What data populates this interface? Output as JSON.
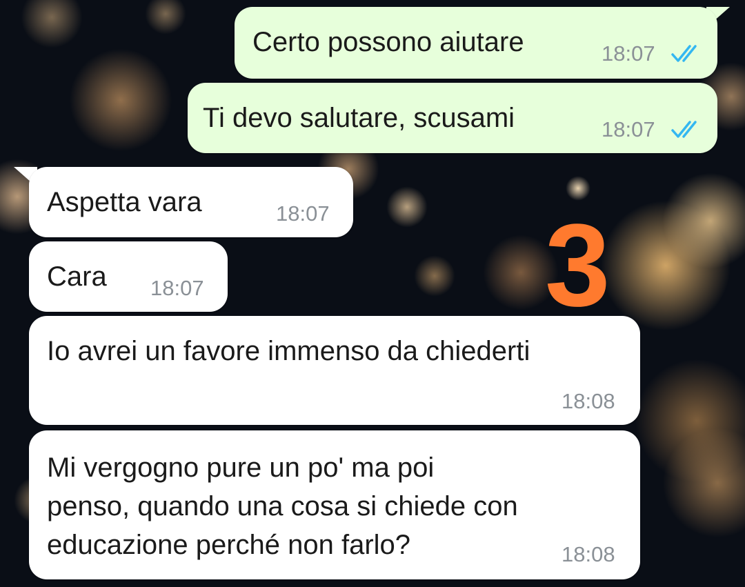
{
  "messages": [
    {
      "text": "Certo possono aiutare",
      "time": "18:07",
      "status": "read",
      "icon": "double-check-icon"
    },
    {
      "text": "Ti devo salutare, scusami",
      "time": "18:07",
      "status": "read",
      "icon": "double-check-icon"
    },
    {
      "text": "Aspetta vara",
      "time": "18:07"
    },
    {
      "text": "Cara",
      "time": "18:07"
    },
    {
      "text": "Io avrei un favore immenso da chiederti",
      "time": "18:08"
    },
    {
      "text": "Mi vergogno pure un po' ma poi\npenso, quando una cosa si chiede con\neducazione perché non farlo?",
      "time": "18:08"
    }
  ],
  "annotation": "3",
  "colors": {
    "outgoing_bubble": "#e7ffdb",
    "incoming_bubble": "#ffffff",
    "read_ticks": "#34b7f1",
    "timestamp": "#8a9096",
    "annotation": "#ff7a2e",
    "background": "#0a0e16"
  }
}
